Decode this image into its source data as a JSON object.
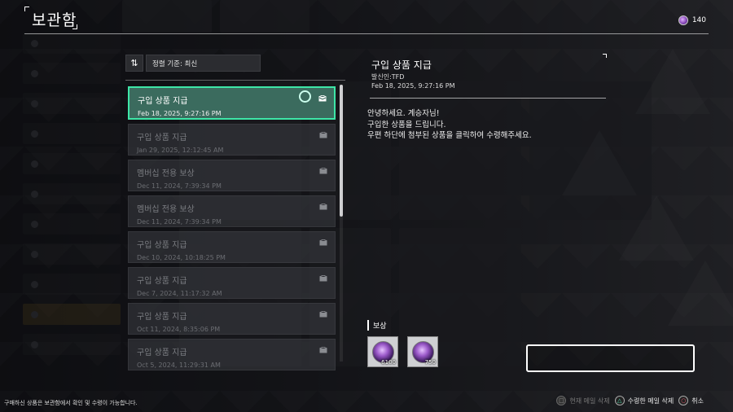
{
  "header": {
    "title": "보관함",
    "currency_amount": "140",
    "currency_icon": "caliber-coin-icon"
  },
  "sort": {
    "label": "정렬 기준: 최신"
  },
  "mail_list": [
    {
      "subject": "구입 상품 지급",
      "date": "Feb 18, 2025, 9:27:16 PM",
      "selected": true
    },
    {
      "subject": "구입 상품 지급",
      "date": "Jan 29, 2025, 12:12:45 AM",
      "selected": false
    },
    {
      "subject": "멤버십 전용 보상",
      "date": "Dec 11, 2024, 7:39:34 PM",
      "selected": false
    },
    {
      "subject": "멤버십 전용 보상",
      "date": "Dec 11, 2024, 7:39:34 PM",
      "selected": false
    },
    {
      "subject": "구입 상품 지급",
      "date": "Dec 10, 2024, 10:18:25 PM",
      "selected": false
    },
    {
      "subject": "구입 상품 지급",
      "date": "Dec 7, 2024, 11:17:32 AM",
      "selected": false
    },
    {
      "subject": "구입 상품 지급",
      "date": "Oct 11, 2024, 8:35:06 PM",
      "selected": false
    },
    {
      "subject": "구입 상품 지급",
      "date": "Oct 5, 2024, 11:29:31 AM",
      "selected": false
    }
  ],
  "detail": {
    "title": "구입 상품 지급",
    "sender": "발신인:TFD",
    "date": "Feb 18, 2025, 9:27:16 PM",
    "body": [
      "안녕하세요. 계승자님!",
      "구입한 상품을 드립니다.",
      "우편 하단에 첨부된 상품을 클릭하여 수령해주세요."
    ],
    "reward_label": "보상",
    "rewards": [
      {
        "icon": "caliber-coin-icon",
        "quantity": "6100"
      },
      {
        "icon": "caliber-coin-icon",
        "quantity": "750"
      }
    ]
  },
  "footer": {
    "note": "구매하신 상품은 보관함에서 확인 및 수령이 가능합니다.",
    "actions": [
      {
        "button": "square",
        "label": "현재 메일 삭제",
        "enabled": false
      },
      {
        "button": "triangle",
        "label": "수령한 메일 삭제",
        "enabled": true
      },
      {
        "button": "circle",
        "label": "취소",
        "enabled": true
      }
    ]
  },
  "colors": {
    "selection_border": "#3ee6a7",
    "selection_fill": "#3b6b5e",
    "triangle_button": "#4fd9b0",
    "circle_button": "#f2637a"
  }
}
